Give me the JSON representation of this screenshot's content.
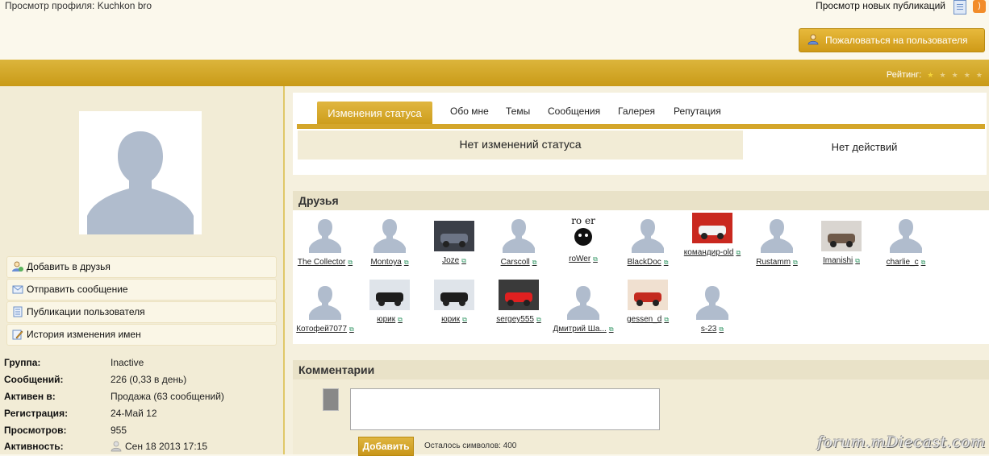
{
  "header": {
    "title": "Просмотр профиля: Kuchkon bro",
    "new_publications": "Просмотр новых публикаций",
    "report_button": "Пожаловаться на пользователя"
  },
  "rating": {
    "label": "Рейтинг:",
    "value": 1,
    "max": 5
  },
  "sidebar": {
    "actions": [
      {
        "label": "Добавить в друзья",
        "icon": "add-friend-icon"
      },
      {
        "label": "Отправить сообщение",
        "icon": "envelope-icon"
      },
      {
        "label": "Публикации пользователя",
        "icon": "document-icon"
      },
      {
        "label": "История изменения имен",
        "icon": "pencil-icon"
      }
    ],
    "info": [
      {
        "key": "Группа:",
        "value": "Inactive"
      },
      {
        "key": "Сообщений:",
        "value": "226 (0,33 в день)"
      },
      {
        "key": "Активен в:",
        "value": "Продажа (63 сообщений)"
      },
      {
        "key": "Регистрация:",
        "value": "24-Май 12"
      },
      {
        "key": "Просмотров:",
        "value": "955"
      },
      {
        "key": "Активность:",
        "value": "Сен 18 2013 17:15"
      }
    ]
  },
  "tabs": {
    "active": "Изменения статуса",
    "items": [
      "Обо мне",
      "Темы",
      "Сообщения",
      "Галерея",
      "Репутация"
    ]
  },
  "status": {
    "left": "Нет изменений статуса",
    "right": "Нет действий"
  },
  "friends": {
    "title": "Друзья",
    "items": [
      {
        "name": "The Collector",
        "photo": "default"
      },
      {
        "name": "Montoya",
        "photo": "default"
      },
      {
        "name": "Joze",
        "photo": "car-dark"
      },
      {
        "name": "Carscoll",
        "photo": "default"
      },
      {
        "name": "roWer",
        "photo": "rower-logo"
      },
      {
        "name": "BlackDoc",
        "photo": "default"
      },
      {
        "name": "командир-old",
        "photo": "santa"
      },
      {
        "name": "Rustamm",
        "photo": "default"
      },
      {
        "name": "Imanishi",
        "photo": "scorpion"
      },
      {
        "name": "charlie_c",
        "photo": "default"
      },
      {
        "name": "Котофей7077",
        "photo": "default"
      },
      {
        "name": "юрик",
        "photo": "jeep-black"
      },
      {
        "name": "юрик",
        "photo": "jeep-black"
      },
      {
        "name": "sergey555",
        "photo": "car-red"
      },
      {
        "name": "Дмитрий Ша...",
        "photo": "default"
      },
      {
        "name": "gessen_d",
        "photo": "collage-red"
      },
      {
        "name": "s-23",
        "photo": "default"
      }
    ]
  },
  "comments": {
    "title": "Комментарии",
    "add_button": "Добавить",
    "remaining": "Осталось символов: 400"
  },
  "watermark": "forum.mDiecast.com"
}
